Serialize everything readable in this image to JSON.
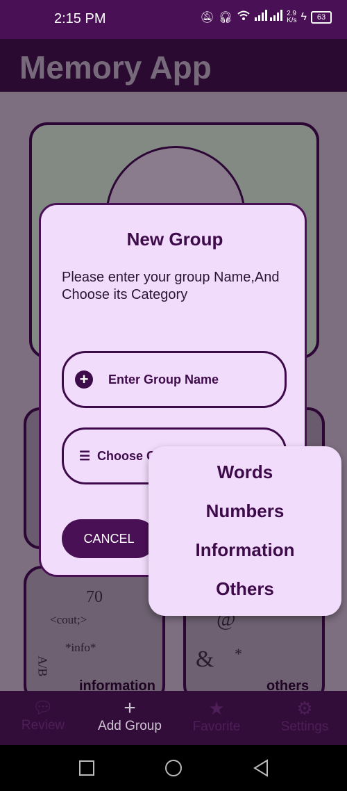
{
  "status_bar": {
    "time": "2:15 PM",
    "net_speed_top": "2.9",
    "net_speed_bottom": "K/s",
    "battery": "63"
  },
  "app": {
    "title": "Memory App"
  },
  "background": {
    "card_information_label": "information",
    "card_others_label": "others",
    "info_symbols": [
      "70",
      "<cout;>",
      "*info*",
      "A/B"
    ],
    "others_symbols": [
      "@",
      "&",
      "*"
    ]
  },
  "dialog": {
    "title": "New Group",
    "description": "Please enter your group Name,And Choose its Category",
    "name_field_label": "Enter Group Name",
    "category_field_label": "Choose G",
    "cancel_label": "CANCEL"
  },
  "dropdown": {
    "options": [
      "Words",
      "Numbers",
      "Information",
      "Others"
    ]
  },
  "bottom_nav": {
    "items": [
      "Review",
      "Add Group",
      "Favorite",
      "Settings"
    ]
  },
  "colors": {
    "primary": "#4a1055",
    "dialog_bg": "#f1dcfb",
    "text_primary": "#3e0b4a"
  }
}
